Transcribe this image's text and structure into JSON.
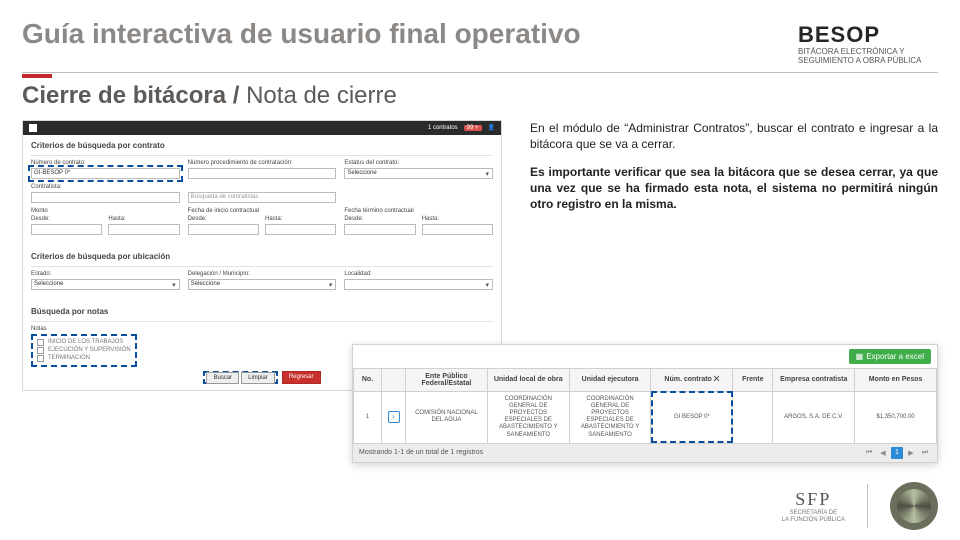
{
  "header": {
    "title": "Guía interactiva de usuario final operativo",
    "brand_logo": "BESOP",
    "brand_tag": "BITÁCORA ELECTRÓNICA Y SEGUIMIENTO A OBRA PÚBLICA"
  },
  "subtitle": {
    "bold": "Cierre de bitácora / ",
    "light": "Nota de cierre"
  },
  "right_text": {
    "p1": "En el módulo de “Administrar Contratos”, buscar el contrato e ingresar a la bitácora que se va a cerrar.",
    "p2": "Es importante verificar que sea la bitácora que se desea cerrar, ya que una vez que se ha firmado esta nota, el sistema no permitirá ningún otro registro en la misma."
  },
  "app": {
    "topbar": {
      "contracts": "1 contratos",
      "badge": "99 +",
      "user_icon": "👤"
    },
    "sec1_title": "Criterios de búsqueda por contrato",
    "labels": {
      "num_contrato": "Número de contrato:",
      "num_proc": "Número procedimiento de contratación:",
      "estatus": "Estatus del contrato:",
      "contratista": "Contratista:",
      "monto": "Monto",
      "inicio": "Fecha de inicio contractual",
      "termino": "Fecha término contractual",
      "desde": "Desde:",
      "hasta": "Hasta:"
    },
    "values": {
      "num_contrato": "GI-BESOP 0*",
      "estatus": "Seleccione",
      "contratista_ph": "Búsqueda de contratistas"
    },
    "sec2_title": "Criterios de búsqueda por ubicación",
    "loc": {
      "estado_lbl": "Estado:",
      "estado_val": "Seleccione",
      "deleg_lbl": "Delegación / Municipio:",
      "deleg_val": "Seleccione",
      "local_lbl": "Localidad:"
    },
    "sec3_title": "Búsqueda por notas",
    "notas_lbl": "Notas",
    "notas": [
      "INICIO DE LOS TRABAJOS",
      "EJECUCIÓN Y SUPERVISIÓN",
      "TERMINACIÓN"
    ],
    "buttons": {
      "buscar": "Buscar",
      "limpiar": "Limpiar",
      "regresar": "Regresar"
    }
  },
  "overlay": {
    "export": "Exportar a excel",
    "headers": [
      "No.",
      "",
      "Ente Público Federal/Estatal",
      "Unidad local de obra",
      "Unidad ejecutora",
      "Núm. contrato ⨉",
      "Frente",
      "Empresa contratista",
      "Monto en Pesos"
    ],
    "row": {
      "no": "1",
      "ente": "COMISIÓN NACIONAL DEL AGUA",
      "ulo": "COORDINACIÓN GENERAL DE PROYECTOS ESPECIALES DE ABASTECIMIENTO Y SANEAMIENTO",
      "ue": "COORDINACIÓN GENERAL DE PROYECTOS ESPECIALES DE ABASTECIMIENTO Y SANEAMIENTO",
      "contrato": "GI BESOP 0*",
      "frente": "",
      "empresa": "ARGOS, S.A. DE C.V.",
      "monto": "$1,350,700.00"
    },
    "pager_text": "Mostrando 1-1 de un total de 1 registros",
    "pager_current": "1"
  },
  "footer": {
    "sfp": "SFP",
    "sfp_sub1": "SECRETARÍA DE",
    "sfp_sub2": "LA FUNCIÓN PÚBLICA"
  }
}
